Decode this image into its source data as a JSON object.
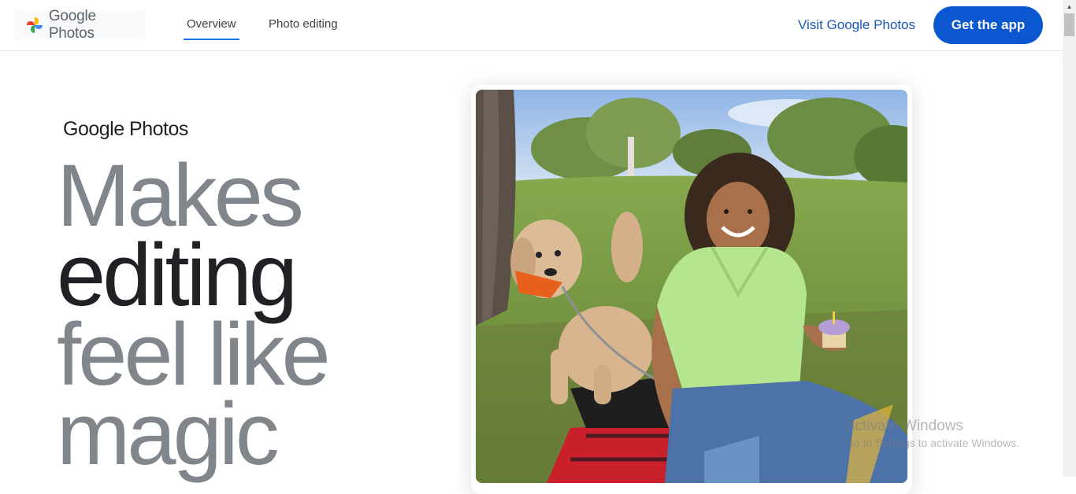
{
  "header": {
    "logo_text": "Google Photos",
    "tabs": [
      {
        "label": "Overview",
        "active": true
      },
      {
        "label": "Photo editing",
        "active": false
      }
    ],
    "visit_link": "Visit Google Photos",
    "cta_button": "Get the app"
  },
  "hero": {
    "brand": "Google Photos",
    "headline": [
      "Makes",
      "editing",
      "feel like",
      "magic"
    ]
  },
  "photo": {
    "description_icon": "photo-image"
  },
  "watermark": {
    "title": "Activate Windows",
    "subtitle": "Go to Settings to activate Windows."
  },
  "colors": {
    "accent": "#0b57d0",
    "link": "#1a57b8",
    "headline_grey": "#80868b",
    "headline_dark": "#202124"
  }
}
